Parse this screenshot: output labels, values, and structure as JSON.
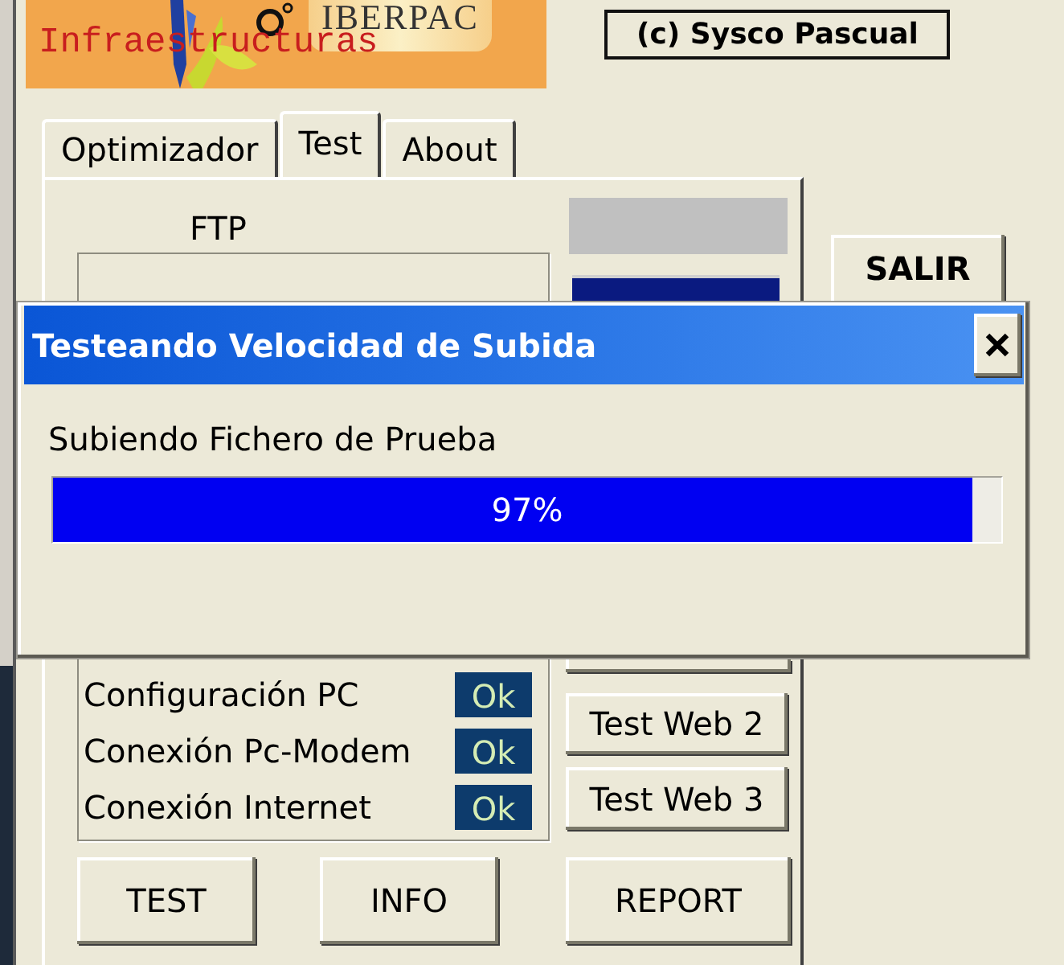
{
  "main_window": {
    "logo": {
      "brand": "IBERPAC",
      "tagline": "Infraestructuras"
    },
    "copyright": "(c) Sysco Pascual",
    "tabs": [
      {
        "label": "Optimizador",
        "selected": false
      },
      {
        "label": "Test",
        "selected": true
      },
      {
        "label": "About",
        "selected": false
      }
    ],
    "test_panel": {
      "ftp_label": "FTP",
      "checks": [
        {
          "label": "Configuración PC",
          "status": "Ok"
        },
        {
          "label": "Conexión Pc-Modem",
          "status": "Ok"
        },
        {
          "label": "Conexión Internet",
          "status": "Ok"
        }
      ],
      "web_buttons": [
        "Test Web 2",
        "Test Web 3"
      ],
      "actions": [
        "TEST",
        "INFO",
        "REPORT"
      ]
    },
    "exit_button": "SALIR"
  },
  "dialog": {
    "title": "Testeando Velocidad de Subida",
    "message": "Subiendo Fichero de Prueba",
    "progress": {
      "level": 0.97,
      "reading": "97%"
    }
  }
}
